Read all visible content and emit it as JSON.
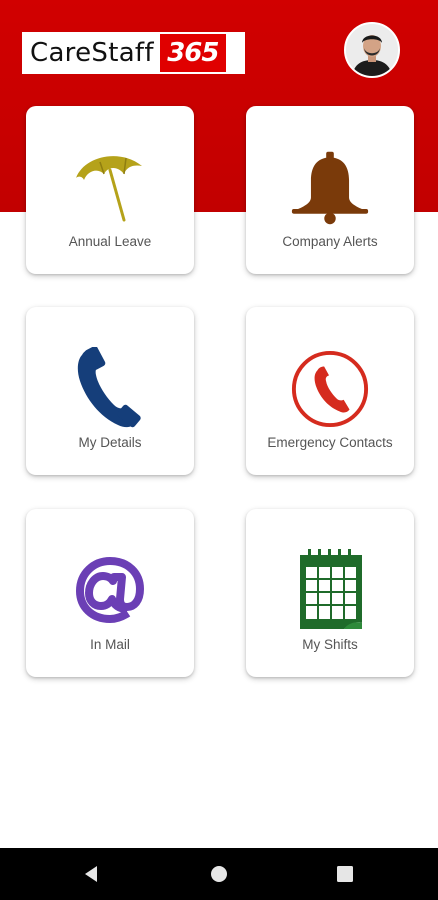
{
  "app": {
    "logo_text": "CareStaff",
    "logo_badge": "365"
  },
  "tiles": [
    {
      "label": "Annual Leave",
      "icon": "umbrella-icon",
      "color": "#b5a21a"
    },
    {
      "label": "Company Alerts",
      "icon": "bell-icon",
      "color": "#7a3a0a"
    },
    {
      "label": "My Details",
      "icon": "phone-icon",
      "color": "#153e7a"
    },
    {
      "label": "Emergency Contacts",
      "icon": "emergency-phone-icon",
      "color": "#d52b1e"
    },
    {
      "label": "In Mail",
      "icon": "at-sign-icon",
      "color": "#6b3fb5"
    },
    {
      "label": "My Shifts",
      "icon": "calendar-icon",
      "color": "#1f6b2a"
    }
  ],
  "theme": {
    "header_red": "#c80000",
    "nav_bar": "#000000"
  },
  "system_nav": {
    "back": "back-icon",
    "home": "home-icon",
    "recents": "recents-icon"
  }
}
